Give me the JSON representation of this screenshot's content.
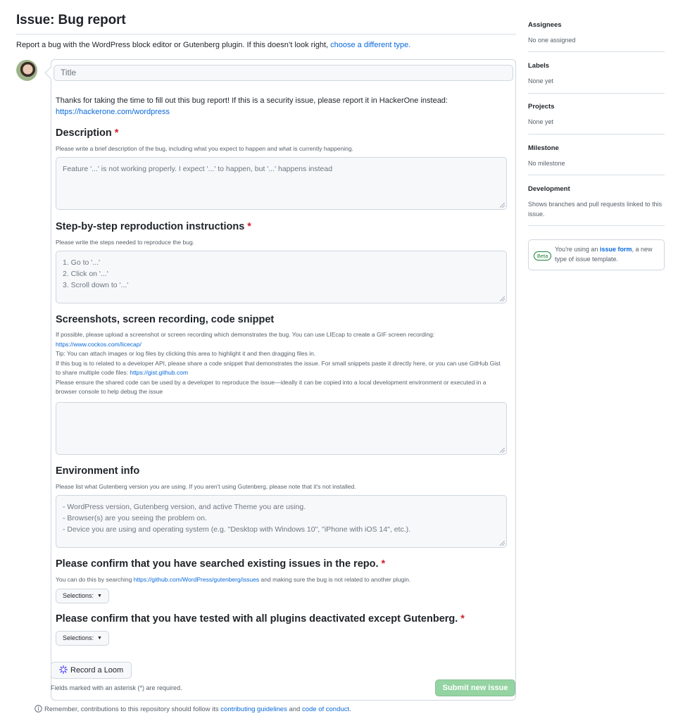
{
  "header": {
    "title": "Issue: Bug report",
    "intro_text": "Report a bug with the WordPress block editor or Gutenberg plugin. If this doesn’t look right, ",
    "intro_link": "choose a different type."
  },
  "form": {
    "title_placeholder": "Title",
    "thanks_text": "Thanks for taking the time to fill out this bug report! If this is a security issue, please report it in HackerOne instead:",
    "thanks_link": "https://hackerone.com/wordpress",
    "fields": [
      {
        "label": "Description",
        "required": true,
        "description": "Please write a brief description of the bug, including what you expect to happen and what is currently happening.",
        "placeholder_lines": [
          "Feature '...' is not working properly. I expect '...' to happen, but '...' happens instead"
        ]
      },
      {
        "label": "Step-by-step reproduction instructions",
        "required": true,
        "description": "Please write the steps needed to reproduce the bug.",
        "placeholder_lines": [
          "1. Go to '...'",
          "2. Click on '...'",
          "3. Scroll down to '...'"
        ]
      },
      {
        "label": "Screenshots, screen recording, code snippet",
        "required": false,
        "description_parts": {
          "p1": "If possible, please upload a screenshot or screen recording which demonstrates the bug. You can use LIEcap to create a GIF screen recording:",
          "link1": "https://www.cockos.com/licecap/",
          "p2": "Tip: You can attach images or log files by clicking this area to highlight it and then dragging files in.",
          "p3": "If this bug is to related to a developer API, please share a code snippet that demonstrates the issue. For small snippets paste it directly here, or you can use GitHub Gist to share multiple code files: ",
          "link2": "https://gist.github.com",
          "p4": "Please ensure the shared code can be used by a developer to reproduce the issue—ideally it can be copied into a local development environment or executed in a browser console to help debug the issue"
        },
        "placeholder_lines": []
      },
      {
        "label": "Environment info",
        "required": false,
        "description": "Please list what Gutenberg version you are using. If you aren't using Gutenberg, please note that it's not installed.",
        "placeholder_lines": [
          "- WordPress version, Gutenberg version, and active Theme you are using.",
          "- Browser(s) are you seeing the problem on.",
          "- Device you are using and operating system (e.g. \"Desktop with Windows 10\", \"iPhone with iOS 14\", etc.)."
        ]
      },
      {
        "label": "Please confirm that you have searched existing issues in the repo.",
        "required": true,
        "description_pre": "You can do this by searching ",
        "description_link": "https://github.com/WordPress/gutenberg/issues",
        "description_post": " and making sure the bug is not related to another plugin.",
        "select_label": "Selections:"
      },
      {
        "label": "Please confirm that you have tested with all plugins deactivated except Gutenberg.",
        "required": true,
        "select_label": "Selections:"
      }
    ],
    "required_marker": "*",
    "loom_button": "Record a Loom",
    "required_note": "Fields marked with an asterisk (*) are required.",
    "submit_button": "Submit new issue"
  },
  "footer": {
    "text_pre": "Remember, contributions to this repository should follow its ",
    "link1": "contributing guidelines",
    "text_mid": " and ",
    "link2": "code of conduct",
    "text_post": "."
  },
  "sidebar": {
    "sections": [
      {
        "title": "Assignees",
        "value": "No one assigned"
      },
      {
        "title": "Labels",
        "value": "None yet"
      },
      {
        "title": "Projects",
        "value": "None yet"
      },
      {
        "title": "Milestone",
        "value": "No milestone"
      },
      {
        "title": "Development",
        "value": "Shows branches and pull requests linked to this issue."
      }
    ],
    "beta": {
      "badge": "Beta",
      "text_pre": "You're using an ",
      "link": "issue form",
      "text_post": ", a new type of issue template."
    }
  },
  "colors": {
    "link": "#0969da",
    "required": "#cf222e",
    "submit_disabled": "#94d3a2",
    "beta_green": "#1a7f37",
    "loom_purple": "#625df5"
  }
}
